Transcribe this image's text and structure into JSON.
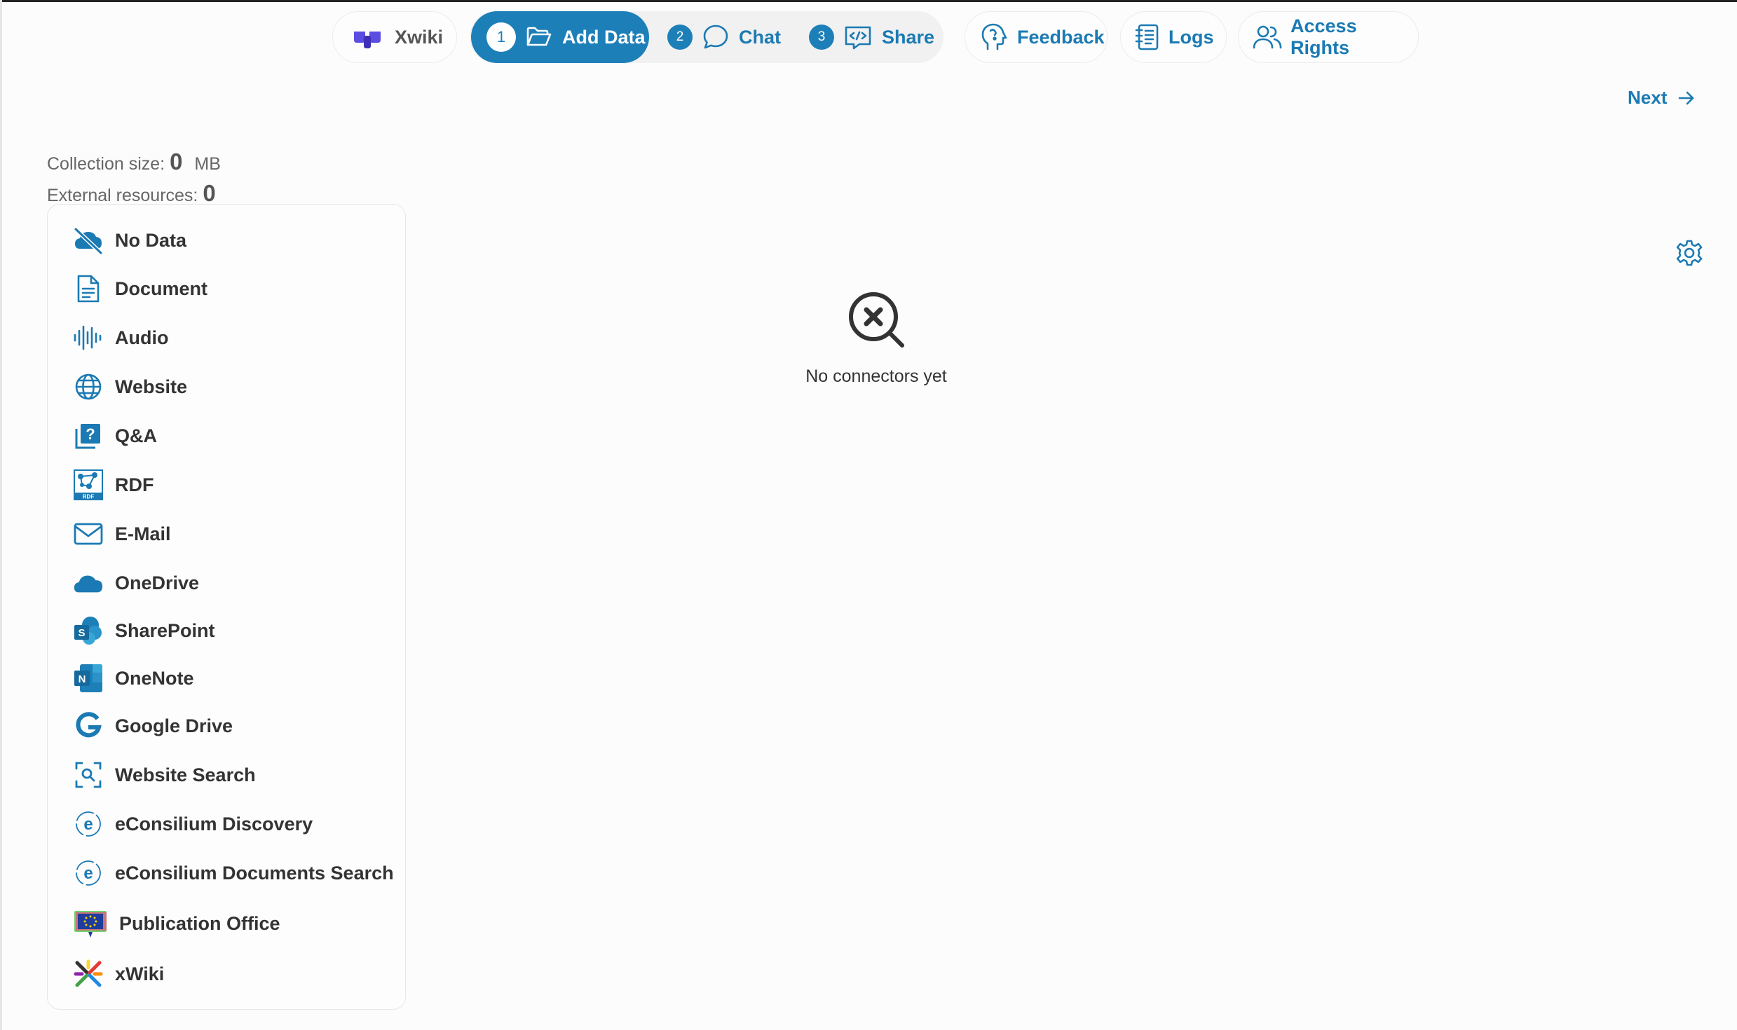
{
  "nav": {
    "app_name": "Xwiki",
    "steps": [
      {
        "num": "1",
        "label": "Add Data",
        "active": true
      },
      {
        "num": "2",
        "label": "Chat",
        "active": false
      },
      {
        "num": "3",
        "label": "Share",
        "active": false
      }
    ],
    "feedback_label": "Feedback",
    "logs_label": "Logs",
    "access_label": "Access Rights"
  },
  "next_label": "Next",
  "stats": {
    "collection_label": "Collection size:",
    "collection_value": "0",
    "collection_unit": "MB",
    "external_label": "External resources:",
    "external_value": "0"
  },
  "sources": [
    {
      "label": "No Data",
      "icon": "cloud-off-icon"
    },
    {
      "label": "Document",
      "icon": "document-icon"
    },
    {
      "label": "Audio",
      "icon": "audio-waveform-icon"
    },
    {
      "label": "Website",
      "icon": "globe-icon"
    },
    {
      "label": "Q&A",
      "icon": "question-icon"
    },
    {
      "label": "RDF",
      "icon": "rdf-icon"
    },
    {
      "label": "E-Mail",
      "icon": "mail-icon"
    },
    {
      "label": "OneDrive",
      "icon": "onedrive-icon"
    },
    {
      "label": "SharePoint",
      "icon": "sharepoint-icon"
    },
    {
      "label": "OneNote",
      "icon": "onenote-icon"
    },
    {
      "label": "Google Drive",
      "icon": "google-icon"
    },
    {
      "label": "Website Search",
      "icon": "website-search-icon"
    },
    {
      "label": "eConsilium Discovery",
      "icon": "econsilium-icon"
    },
    {
      "label": "eConsilium Documents Search",
      "icon": "econsilium-icon"
    },
    {
      "label": "Publication Office",
      "icon": "publication-office-icon"
    },
    {
      "label": "xWiki",
      "icon": "xwiki-icon"
    }
  ],
  "empty_state": {
    "message": "No connectors yet",
    "icon": "search-x-icon"
  },
  "colors": {
    "accent": "#1d7fb8",
    "text": "#333333",
    "muted": "#666666"
  }
}
